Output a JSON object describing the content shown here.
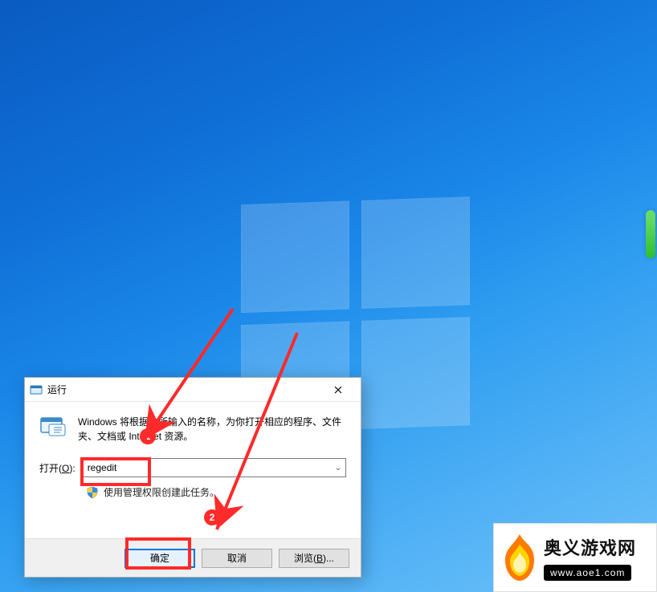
{
  "dialog": {
    "title": "运行",
    "description": "Windows 将根据你所输入的名称，为你打开相应的程序、文件夹、文档或 Internet 资源。",
    "open_label_prefix": "打开(",
    "open_label_access": "O",
    "open_label_suffix": "):",
    "input_value": "regedit",
    "admin_note": "使用管理权限创建此任务。",
    "buttons": {
      "ok": "确定",
      "cancel": "取消",
      "browse_prefix": "浏览(",
      "browse_access": "B",
      "browse_suffix": ")..."
    }
  },
  "annotations": {
    "badge1": "1",
    "badge2": "2"
  },
  "watermark": {
    "site_name": "奥义游戏网",
    "site_url": "www.aoe1.com"
  },
  "colors": {
    "highlight": "#ff2a2a",
    "accent": "#0078d7"
  }
}
